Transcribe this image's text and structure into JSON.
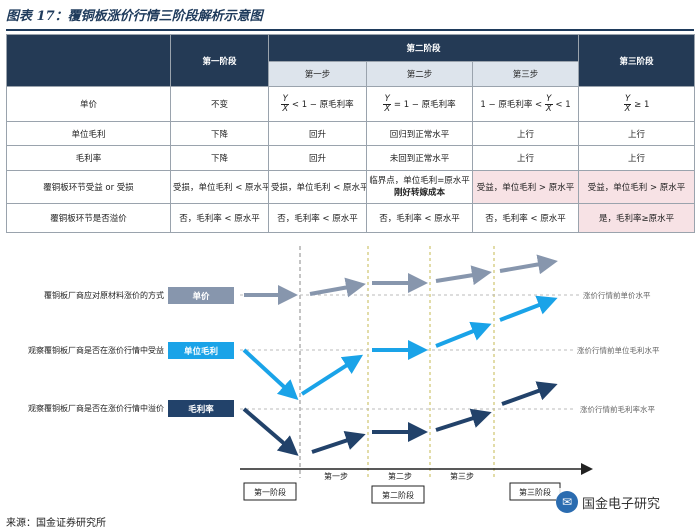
{
  "title": "图表 17：覆铜板涨价行情三阶段解析示意图",
  "table": {
    "headers": {
      "stage1": "第一阶段",
      "stage2": "第二阶段",
      "stage3": "第三阶段",
      "step1": "第一步",
      "step2": "第二步",
      "step3": "第三步"
    },
    "rows": {
      "price": {
        "label": "单价",
        "s1": "不变",
        "f_num": "Y",
        "f_den": "X",
        "step1_rest": "< 1 − 原毛利率",
        "step2_rest": "= 1 − 原毛利率",
        "step3_left": "1 − 原毛利率 <",
        "step3_rest": "< 1",
        "s3_rest": "≥ 1"
      },
      "unit_margin": {
        "label": "单位毛利",
        "s1": "下降",
        "step1": "回升",
        "step2": "回归到正常水平",
        "step3": "上行",
        "s3": "上行"
      },
      "margin_rate": {
        "label": "毛利率",
        "s1": "下降",
        "step1": "回升",
        "step2": "未回到正常水平",
        "step3": "上行",
        "s3": "上行"
      },
      "benefit": {
        "label": "覆铜板环节受益 or 受损",
        "s1": "受损，单位毛利 < 原水平",
        "step1": "受损，单位毛利 < 原水平",
        "step2_a": "临界点，单位毛利=原水平",
        "step2_b": "刚好转嫁成本",
        "step3": "受益，单位毛利 > 原水平",
        "s3": "受益，单位毛利 > 原水平"
      },
      "premium": {
        "label": "覆铜板环节是否溢价",
        "s1": "否，毛利率 < 原水平",
        "step1": "否，毛利率 < 原水平",
        "step2": "否，毛利率 < 原水平",
        "step3": "否，毛利率 < 原水平",
        "s3": "是，毛利率≥原水平"
      }
    }
  },
  "diagram": {
    "left_labels": [
      "覆铜板厂商应对原材料涨价的方式",
      "观察覆铜板厂商是否在涨价行情中受益",
      "观察覆铜板厂商是否在涨价行情中溢价"
    ],
    "tags": [
      "单价",
      "单位毛利",
      "毛利率"
    ],
    "right_labels": [
      "涨价行情前单价水平",
      "涨价行情前单位毛利水平",
      "涨价行情前毛利率水平"
    ],
    "steps": [
      "第一步",
      "第二步",
      "第三步"
    ],
    "stages": [
      "第一阶段",
      "第二阶段",
      "第三阶段"
    ],
    "colors": {
      "price": "#8796ad",
      "unit_margin": "#1aa3e8",
      "margin_rate": "#22426a",
      "header": "#243a55"
    }
  },
  "footer": "来源：国金证券研究所",
  "watermark": "国金电子研究"
}
